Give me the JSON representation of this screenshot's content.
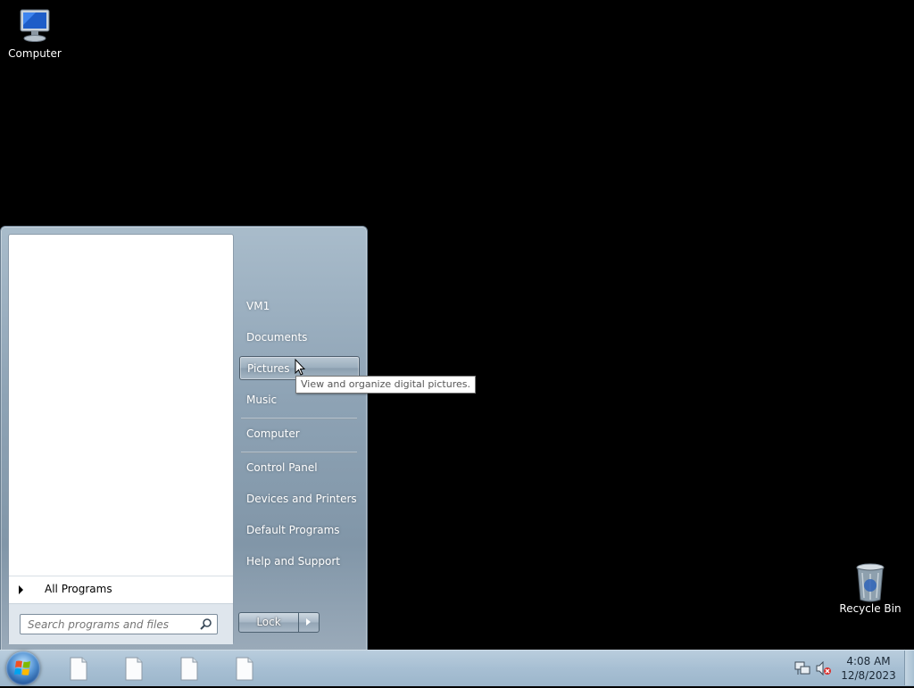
{
  "desktop": {
    "icons": [
      {
        "label": "Computer"
      },
      {
        "label": "Recycle Bin"
      }
    ]
  },
  "start_menu": {
    "all_programs": "All Programs",
    "search_placeholder": "Search programs and files",
    "right_items": [
      "VM1",
      "Documents",
      "Pictures",
      "Music",
      "Computer",
      "Control Panel",
      "Devices and Printers",
      "Default Programs",
      "Help and Support"
    ],
    "selected_item": "Pictures",
    "lock_label": "Lock",
    "tooltip": "View and organize digital pictures."
  },
  "taskbar": {
    "pinned_icons": [
      "file-icon",
      "file-icon",
      "file-icon",
      "file-icon"
    ],
    "tray_icons": [
      "network-icon",
      "volume-muted-icon"
    ],
    "clock_time": "4:08 AM",
    "clock_date": "12/8/2023"
  },
  "colors": {
    "desktop_bg": "#000000",
    "start_menu_bg": "#8ea3b5",
    "taskbar_bg": "#a7bfd3"
  }
}
